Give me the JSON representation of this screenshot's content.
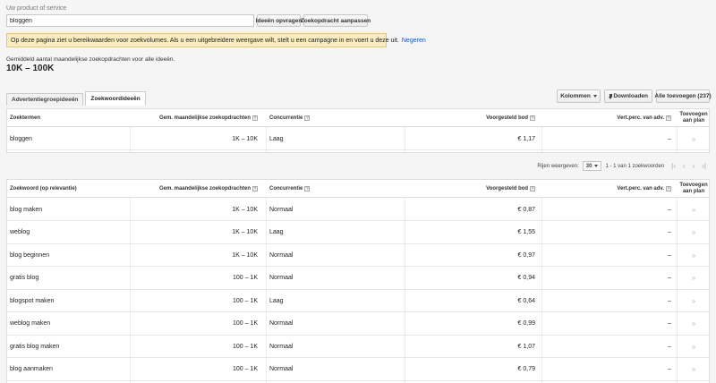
{
  "form": {
    "label": "Uw product of service",
    "value": "bloggen",
    "btn_ideas": "Ideeën opvragen",
    "btn_adjust": "Zoekopdracht aanpassen"
  },
  "notice": {
    "text": "Op deze pagina ziet u bereikwaarden voor zoekvolumes. Als u een uitgebreidere weergave wilt, stelt u een campagne in en voert u deze uit.",
    "link": "Negeren"
  },
  "summary": {
    "label": "Gemiddeld aantal maandelijkse zoekopdrachten voor alle ideeën.",
    "value": "10K – 100K"
  },
  "tabs": [
    {
      "label": "Advertentiegroepideeën",
      "active": false
    },
    {
      "label": "Zoekwoordideeën",
      "active": true
    }
  ],
  "actions": {
    "columns": "Kolommen",
    "download": "Downloaden",
    "add_all": "Alle toevoegen (237)"
  },
  "icons": {
    "help": "help-icon",
    "download": "download-icon",
    "add": "add-to-plan-icon",
    "caret": "caret-down-icon"
  },
  "colors": {
    "notice_bg": "#f9edbe",
    "link": "#1155cc"
  },
  "table1": {
    "headers": {
      "keyword": "Zoektermen",
      "volume": "Gem. maandelijkse zoekopdrachten",
      "competition": "Concurrentie",
      "bid": "Voorgesteld bod",
      "share": "Vert.perc. van adv.",
      "add": "Toevoegen aan plan"
    },
    "rows": [
      {
        "keyword": "bloggen",
        "volume": "1K – 10K",
        "competition": "Laag",
        "bid": "€ 1,17",
        "share": "–",
        "add": "»"
      }
    ]
  },
  "pager": {
    "rows_label": "Rijen weergeven:",
    "rows_value": "30",
    "range_text": "1 - 1 van 1 zoekwoorden",
    "first": "|‹",
    "prev": "‹",
    "next": "›",
    "last": "›|"
  },
  "table2": {
    "headers": {
      "keyword": "Zoekwoord (op relevantie)",
      "volume": "Gem. maandelijkse zoekopdrachten",
      "competition": "Concurrentie",
      "bid": "Voorgesteld bod",
      "share": "Vert.perc. van adv.",
      "add": "Toevoegen aan plan"
    },
    "rows": [
      {
        "keyword": "blog maken",
        "volume": "1K – 10K",
        "competition": "Normaal",
        "bid": "€ 0,87",
        "share": "–",
        "add": "»"
      },
      {
        "keyword": "weblog",
        "volume": "1K – 10K",
        "competition": "Laag",
        "bid": "€ 1,55",
        "share": "–",
        "add": "»"
      },
      {
        "keyword": "blog beginnen",
        "volume": "1K – 10K",
        "competition": "Normaal",
        "bid": "€ 0,97",
        "share": "–",
        "add": "»"
      },
      {
        "keyword": "gratis blog",
        "volume": "100 – 1K",
        "competition": "Normaal",
        "bid": "€ 0,94",
        "share": "–",
        "add": "»"
      },
      {
        "keyword": "blogspot maken",
        "volume": "100 – 1K",
        "competition": "Laag",
        "bid": "€ 0,64",
        "share": "–",
        "add": "»"
      },
      {
        "keyword": "weblog maken",
        "volume": "100 – 1K",
        "competition": "Normaal",
        "bid": "€ 0,99",
        "share": "–",
        "add": "»"
      },
      {
        "keyword": "gratis blog maken",
        "volume": "100 – 1K",
        "competition": "Normaal",
        "bid": "€ 1,07",
        "share": "–",
        "add": "»"
      },
      {
        "keyword": "blog aanmaken",
        "volume": "100 – 1K",
        "competition": "Normaal",
        "bid": "€ 0,79",
        "share": "–",
        "add": "»"
      }
    ]
  }
}
